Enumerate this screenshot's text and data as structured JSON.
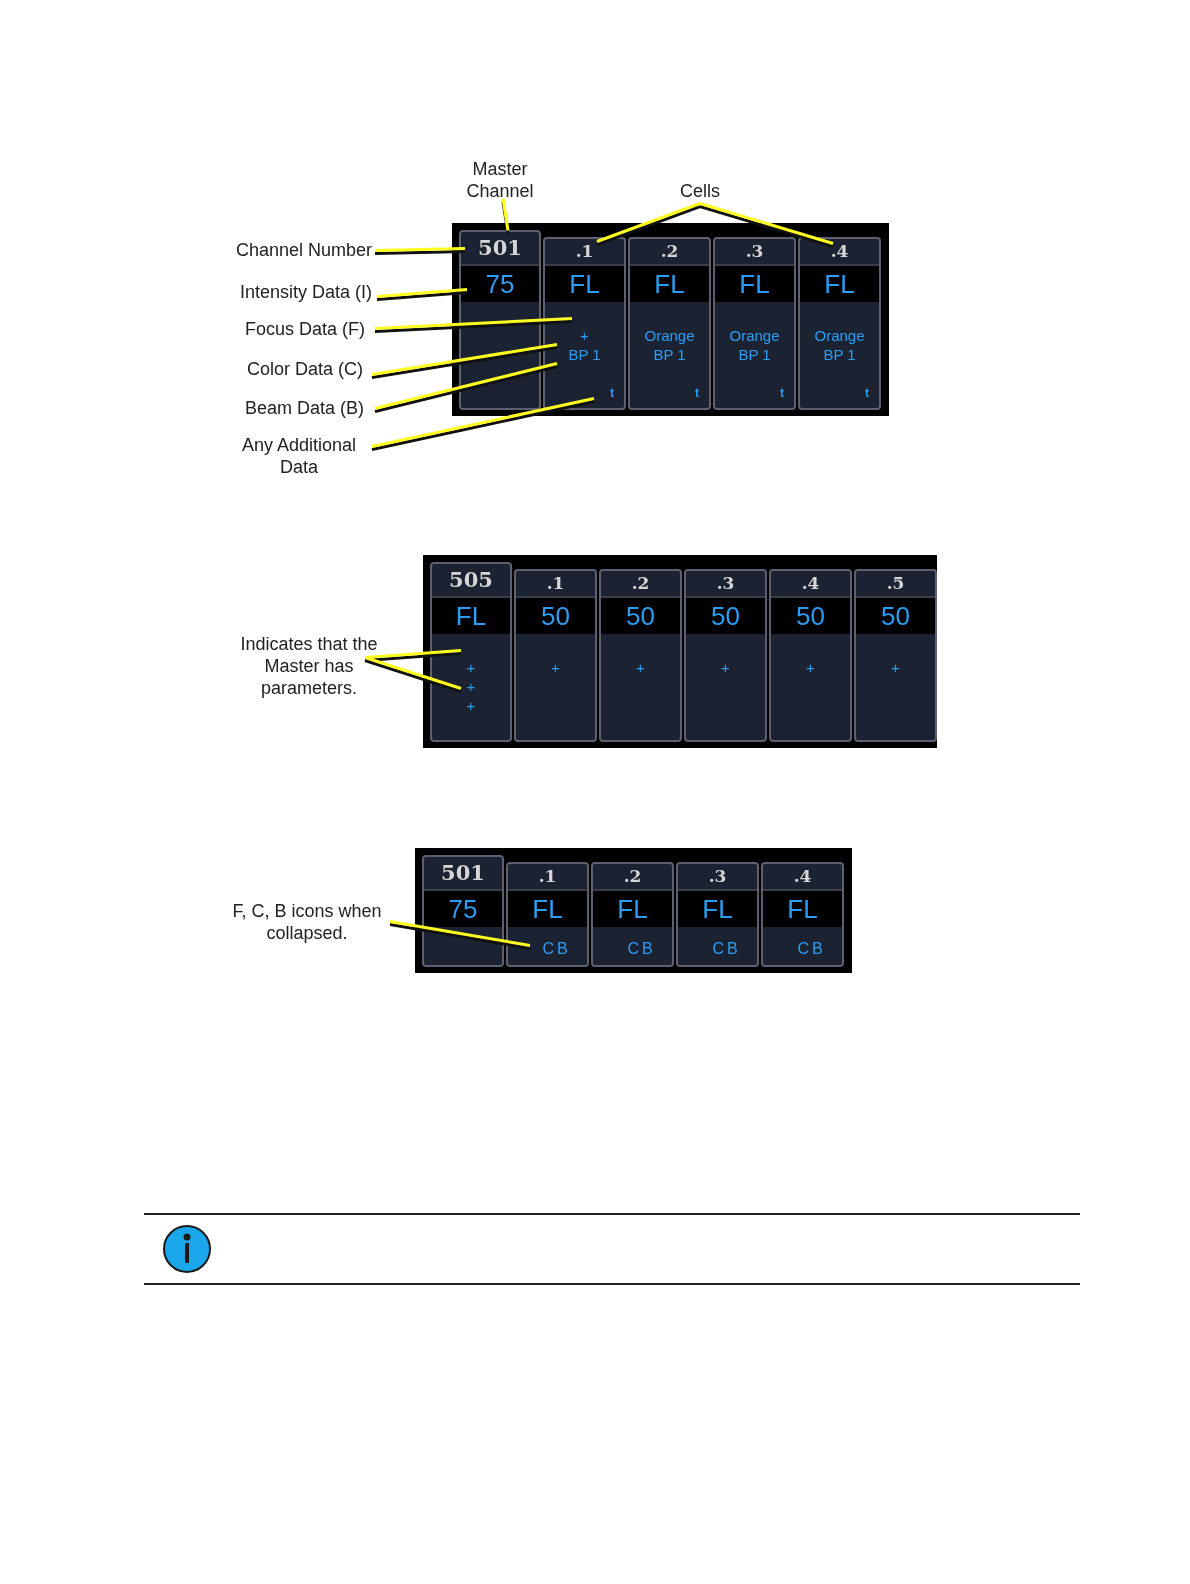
{
  "figures": [
    {
      "kind": "expanded",
      "labels": [
        "Master Channel",
        "Cells",
        "Channel Number",
        "Intensity Data (I)",
        "Focus Data (F)",
        "Color Data (C)",
        "Beam Data (B)",
        "Any Additional Data"
      ],
      "master": {
        "number": "501",
        "intensity": "75"
      },
      "cells": [
        {
          "number": ".1",
          "intensity": "FL",
          "lines": [
            "+",
            "BP 1"
          ],
          "extra": "t"
        },
        {
          "number": ".2",
          "intensity": "FL",
          "lines": [
            "Orange",
            "BP 1"
          ],
          "extra": "t"
        },
        {
          "number": ".3",
          "intensity": "FL",
          "lines": [
            "Orange",
            "BP 1"
          ],
          "extra": "t"
        },
        {
          "number": ".4",
          "intensity": "FL",
          "lines": [
            "Orange",
            "BP 1"
          ],
          "extra": "t"
        }
      ]
    },
    {
      "kind": "expanded",
      "labels": [
        "Indicates that the Master has parameters."
      ],
      "master": {
        "number": "505",
        "intensity": "FL",
        "lines": [
          "+",
          "+",
          "+"
        ]
      },
      "cells": [
        {
          "number": ".1",
          "intensity": "50",
          "lines": [
            "+"
          ]
        },
        {
          "number": ".2",
          "intensity": "50",
          "lines": [
            "+"
          ]
        },
        {
          "number": ".3",
          "intensity": "50",
          "lines": [
            "+"
          ]
        },
        {
          "number": ".4",
          "intensity": "50",
          "lines": [
            "+"
          ]
        },
        {
          "number": ".5",
          "intensity": "50",
          "lines": [
            "+"
          ]
        }
      ]
    },
    {
      "kind": "collapsed",
      "labels": [
        "F, C, B icons when collapsed."
      ],
      "master": {
        "number": "501",
        "intensity": "75"
      },
      "cells": [
        {
          "number": ".1",
          "intensity": "FL",
          "lines": [
            "CB"
          ]
        },
        {
          "number": ".2",
          "intensity": "FL",
          "lines": [
            "CB"
          ]
        },
        {
          "number": ".3",
          "intensity": "FL",
          "lines": [
            "CB"
          ]
        },
        {
          "number": ".4",
          "intensity": "FL",
          "lines": [
            "CB"
          ]
        }
      ]
    }
  ]
}
